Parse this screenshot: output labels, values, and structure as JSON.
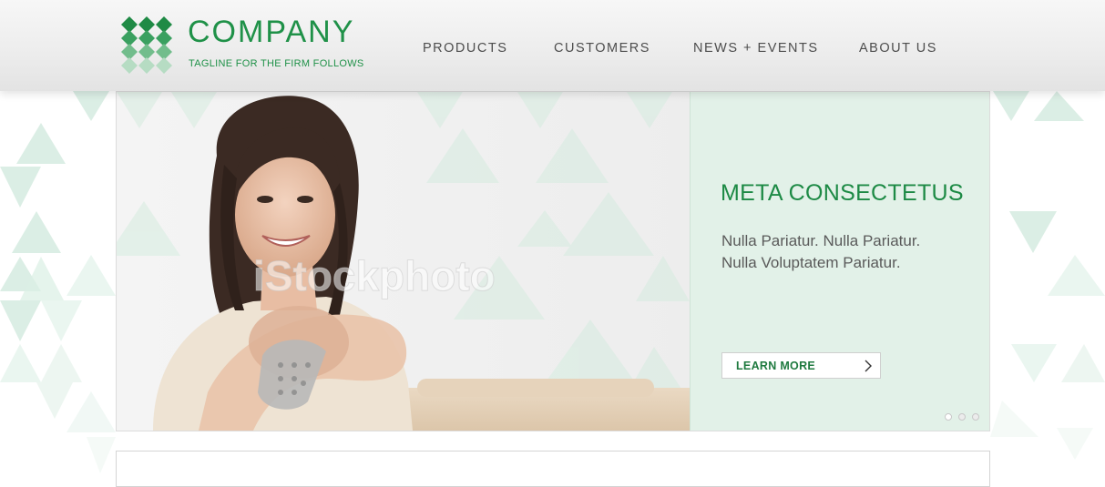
{
  "header": {
    "brand": "COMPANY",
    "tagline": "TAGLINE FOR THE FIRM FOLLOWS",
    "logo_icon": "diamond-grid-logo-icon"
  },
  "nav": {
    "items": [
      {
        "label": "PRODUCTS"
      },
      {
        "label": "CUSTOMERS"
      },
      {
        "label": "NEWS + EVENTS"
      },
      {
        "label": "ABOUT US"
      }
    ]
  },
  "hero": {
    "photo_watermark": "iStockphoto",
    "title": "META CONSECTETUS",
    "body_lines": [
      "Nulla Pariatur. Nulla Pariatur.",
      "Nulla Voluptatem Pariatur."
    ],
    "button_label": "LEARN MORE",
    "button_icon": "chevron-right-icon",
    "slide_count": 3,
    "active_slide": 1
  },
  "colors": {
    "brand_green": "#1f9148",
    "panel_bg": "#e2f1e8",
    "pattern_green": "#cfe9dc",
    "nav_text": "#4d4d4d"
  }
}
